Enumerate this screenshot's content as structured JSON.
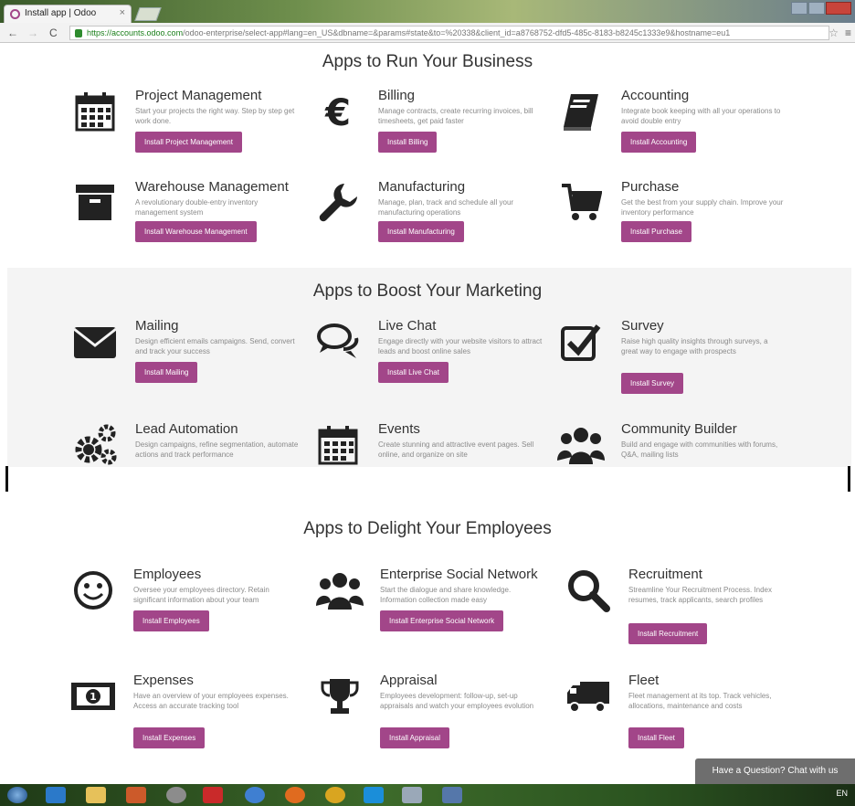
{
  "browser": {
    "tab_title": "Install app | Odoo",
    "url_host": "https://accounts.odoo.com",
    "url_path": "/odoo-enterprise/select-app#lang=en_US&dbname=&params#state&to=%20338&client_id=a8768752-dfd5-485c-8183-b8245c1333e9&hostname=eu1",
    "close_glyph": "×",
    "back_glyph": "←",
    "forward_glyph": "→",
    "reload_glyph": "C",
    "star_glyph": "☆"
  },
  "sections": [
    {
      "title": "Apps to Run Your Business",
      "apps": [
        {
          "name": "Project Management",
          "desc": "Start your projects the right way. Step by step get work done.",
          "button": "Install Project Management",
          "icon": "calendar-icon"
        },
        {
          "name": "Billing",
          "desc": "Manage contracts, create recurring invoices, bill timesheets, get paid faster",
          "button": "Install Billing",
          "icon": "euro-icon"
        },
        {
          "name": "Accounting",
          "desc": "Integrate book keeping with all your operations to avoid double entry",
          "button": "Install Accounting",
          "icon": "book-icon"
        },
        {
          "name": "Warehouse Management",
          "desc": "A revolutionary double-entry inventory management system",
          "button": "Install Warehouse Management",
          "icon": "archive-icon"
        },
        {
          "name": "Manufacturing",
          "desc": "Manage, plan, track and schedule all your manufacturing operations",
          "button": "Install Manufacturing",
          "icon": "wrench-icon"
        },
        {
          "name": "Purchase",
          "desc": "Get the best from your supply chain. Improve your inventory performance",
          "button": "Install Purchase",
          "icon": "cart-icon"
        }
      ]
    },
    {
      "title": "Apps to Boost Your Marketing",
      "apps": [
        {
          "name": "Mailing",
          "desc": "Design efficient emails campaigns. Send, convert and track your success",
          "button": "Install Mailing",
          "icon": "envelope-icon"
        },
        {
          "name": "Live Chat",
          "desc": "Engage directly with your website visitors to attract leads and boost online sales",
          "button": "Install Live Chat",
          "icon": "chat-bubbles-icon"
        },
        {
          "name": "Survey",
          "desc": "Raise high quality insights through surveys, a great way to engage with prospects",
          "button": "Install Survey",
          "icon": "checkbox-icon"
        },
        {
          "name": "Lead Automation",
          "desc": "Design campaigns, refine segmentation, automate actions and track performance",
          "button": "",
          "icon": "gears-icon"
        },
        {
          "name": "Events",
          "desc": "Create stunning and attractive event pages. Sell online, and organize on site",
          "button": "",
          "icon": "calendar-icon"
        },
        {
          "name": "Community Builder",
          "desc": "Build and engage with communities with forums, Q&A, mailing lists",
          "button": "",
          "icon": "group-icon"
        }
      ]
    },
    {
      "title": "Apps to Delight Your Employees",
      "apps": [
        {
          "name": "Employees",
          "desc": "Oversee your employees directory. Retain significant information about your team",
          "button": "Install Employees",
          "icon": "smiley-icon"
        },
        {
          "name": "Enterprise Social Network",
          "desc": "Start the dialogue and share knowledge. Information collection made easy",
          "button": "Install Enterprise Social Network",
          "icon": "group-icon"
        },
        {
          "name": "Recruitment",
          "desc": "Streamline Your Recruitment Process. Index resumes, track applicants, search profiles",
          "button": "Install Recruitment",
          "icon": "magnifier-icon"
        },
        {
          "name": "Expenses",
          "desc": "Have an overview of your employees expenses. Access an accurate tracking tool",
          "button": "Install Expenses",
          "icon": "money-icon"
        },
        {
          "name": "Appraisal",
          "desc": "Employees development: follow-up, set-up appraisals and watch your employees evolution",
          "button": "Install Appraisal",
          "icon": "trophy-icon"
        },
        {
          "name": "Fleet",
          "desc": "Fleet management at its top. Track vehicles, allocations, maintenance and costs",
          "button": "Install Fleet",
          "icon": "truck-icon"
        }
      ]
    }
  ],
  "chat_widget": "Have a Question? Chat with us",
  "taskbar": {
    "tray_text": "EN"
  }
}
